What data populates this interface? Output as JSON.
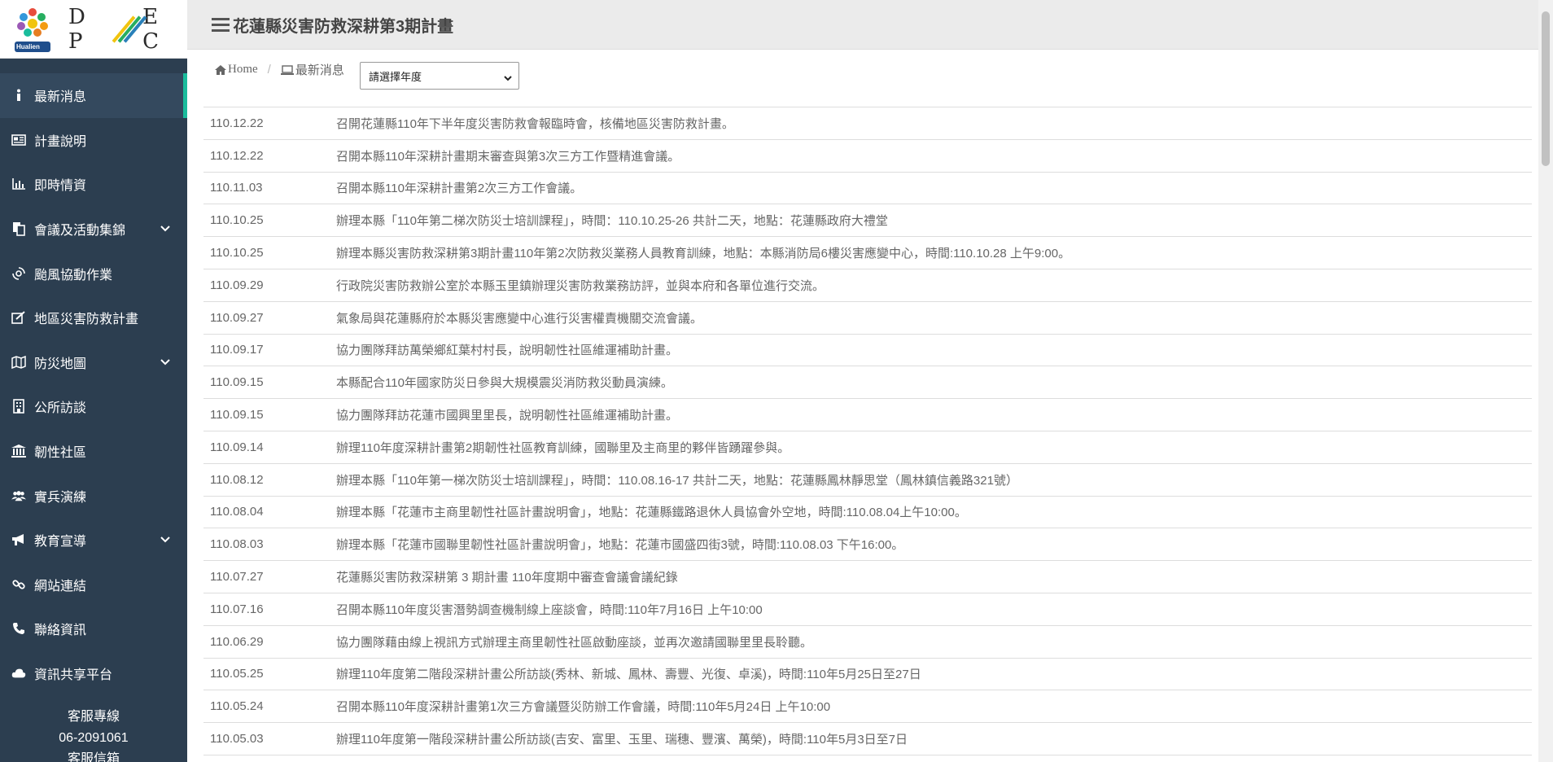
{
  "logo": {
    "badge_text": "Hualien",
    "wordmark_left": "D P",
    "wordmark_right": "E C"
  },
  "sidebar": {
    "items": [
      {
        "label": "最新消息",
        "icon": "info-icon",
        "active": true,
        "has_submenu": false
      },
      {
        "label": "計畫說明",
        "icon": "newspaper-icon",
        "active": false,
        "has_submenu": false
      },
      {
        "label": "即時情資",
        "icon": "bar-chart-icon",
        "active": false,
        "has_submenu": false
      },
      {
        "label": "會議及活動集錦",
        "icon": "copy-icon",
        "active": false,
        "has_submenu": true
      },
      {
        "label": "颱風協動作業",
        "icon": "typhoon-icon",
        "active": false,
        "has_submenu": false
      },
      {
        "label": "地區災害防救計畫",
        "icon": "edit-icon",
        "active": false,
        "has_submenu": false
      },
      {
        "label": "防災地圖",
        "icon": "map-icon",
        "active": false,
        "has_submenu": true
      },
      {
        "label": "公所訪談",
        "icon": "building-icon",
        "active": false,
        "has_submenu": false
      },
      {
        "label": "韌性社區",
        "icon": "institution-icon",
        "active": false,
        "has_submenu": false
      },
      {
        "label": "實兵演練",
        "icon": "users-icon",
        "active": false,
        "has_submenu": false
      },
      {
        "label": "教育宣導",
        "icon": "bullhorn-icon",
        "active": false,
        "has_submenu": true
      },
      {
        "label": "網站連結",
        "icon": "link-icon",
        "active": false,
        "has_submenu": false
      },
      {
        "label": "聯絡資訊",
        "icon": "phone-icon",
        "active": false,
        "has_submenu": false
      },
      {
        "label": "資訊共享平台",
        "icon": "cloud-icon",
        "active": false,
        "has_submenu": false
      }
    ],
    "service": {
      "line_label": "客服專線",
      "phone": "06-2091061",
      "mailbox_label": "客服信箱"
    }
  },
  "header": {
    "title": "花蓮縣災害防救深耕第3期計畫"
  },
  "breadcrumb": {
    "home": "Home",
    "current": "最新消息"
  },
  "year_select": {
    "selected": "請選擇年度"
  },
  "news": [
    {
      "date": "110.12.22",
      "title": "召開花蓮縣110年下半年度災害防救會報臨時會，核備地區災害防救計畫。"
    },
    {
      "date": "110.12.22",
      "title": "召開本縣110年深耕計畫期末審查與第3次三方工作暨精進會議。"
    },
    {
      "date": "110.11.03",
      "title": "召開本縣110年深耕計畫第2次三方工作會議。"
    },
    {
      "date": "110.10.25",
      "title": "辦理本縣「110年第二梯次防災士培訓課程」，時間：110.10.25-26 共計二天，地點：花蓮縣政府大禮堂"
    },
    {
      "date": "110.10.25",
      "title": "辦理本縣災害防救深耕第3期計畫110年第2次防救災業務人員教育訓練，地點：本縣消防局6樓災害應變中心，時間:110.10.28 上午9:00。"
    },
    {
      "date": "110.09.29",
      "title": "行政院災害防救辦公室於本縣玉里鎮辦理災害防救業務訪評，並與本府和各單位進行交流。"
    },
    {
      "date": "110.09.27",
      "title": "氣象局與花蓮縣府於本縣災害應變中心進行災害權責機關交流會議。"
    },
    {
      "date": "110.09.17",
      "title": "協力團隊拜訪萬榮鄉紅葉村村長，說明韌性社區維運補助計畫。"
    },
    {
      "date": "110.09.15",
      "title": "本縣配合110年國家防災日參與大規模震災消防救災動員演練。"
    },
    {
      "date": "110.09.15",
      "title": "協力團隊拜訪花蓮市國興里里長，說明韌性社區維運補助計畫。"
    },
    {
      "date": "110.09.14",
      "title": "辦理110年度深耕計畫第2期韌性社區教育訓練，國聯里及主商里的夥伴皆踴躍參與。"
    },
    {
      "date": "110.08.12",
      "title": "辦理本縣「110年第一梯次防災士培訓課程」，時間：110.08.16-17 共計二天，地點：花蓮縣鳳林靜思堂（鳳林鎮信義路321號）"
    },
    {
      "date": "110.08.04",
      "title": "辦理本縣「花蓮市主商里韌性社區計畫說明會」，地點：花蓮縣鐵路退休人員協會外空地，時間:110.08.04上午10:00。"
    },
    {
      "date": "110.08.03",
      "title": "辦理本縣「花蓮市國聯里韌性社區計畫說明會」，地點：花蓮市國盛四街3號，時間:110.08.03 下午16:00。"
    },
    {
      "date": "110.07.27",
      "title": "花蓮縣災害防救深耕第 3 期計畫 110年度期中審查會議會議紀錄"
    },
    {
      "date": "110.07.16",
      "title": "召開本縣110年度災害潛勢調查機制線上座談會，時間:110年7月16日 上午10:00"
    },
    {
      "date": "110.06.29",
      "title": "協力團隊藉由線上視訊方式辦理主商里韌性社區啟動座談，並再次邀請國聯里里長聆聽。"
    },
    {
      "date": "110.05.25",
      "title": "辦理110年度第二階段深耕計畫公所訪談(秀林、新城、鳳林、壽豐、光復、卓溪)，時間:110年5月25日至27日"
    },
    {
      "date": "110.05.24",
      "title": "召開本縣110年度深耕計畫第1次三方會議暨災防辦工作會議，時間:110年5月24日 上午10:00"
    },
    {
      "date": "110.05.03",
      "title": "辦理110年度第一階段深耕計畫公所訪談(吉安、富里、玉里、瑞穗、豐濱、萬榮)，時間:110年5月3日至7日"
    }
  ],
  "colors": {
    "sidebar_bg": "#2c3e50",
    "active_accent": "#1abc9c",
    "topbar_bg": "#ebebeb"
  }
}
